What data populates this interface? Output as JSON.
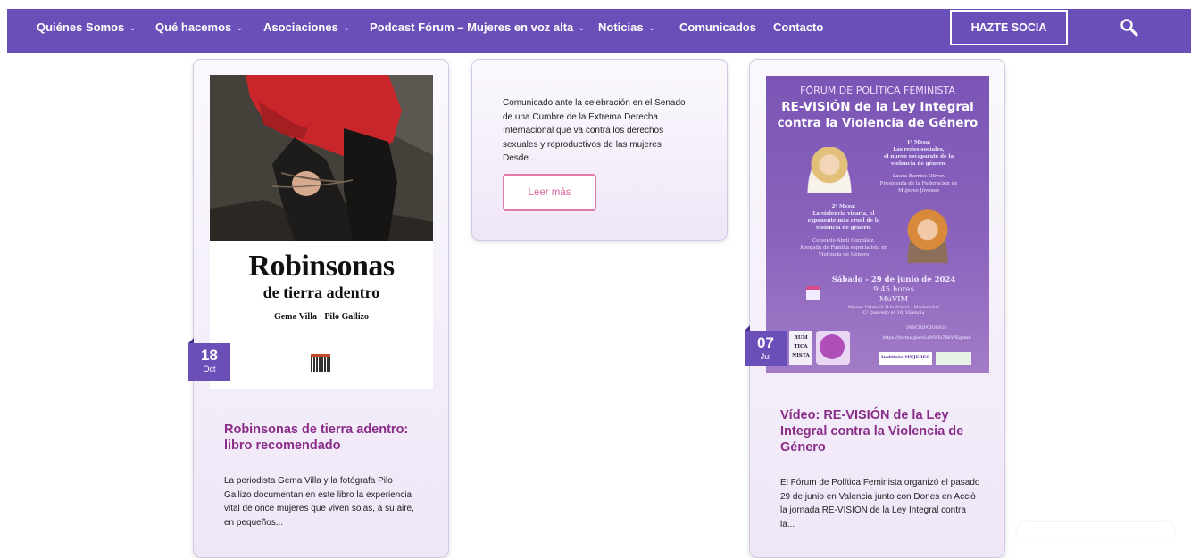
{
  "nav": {
    "items": [
      {
        "label": "Quiénes Somos",
        "chevron": true
      },
      {
        "label": "Qué hacemos",
        "chevron": true
      },
      {
        "label": "Asociaciones",
        "chevron": true
      },
      {
        "label": "Podcast Fórum – Mujeres en voz alta",
        "chevron": true
      },
      {
        "label": "Noticias",
        "chevron": true
      },
      {
        "label": "Comunicados",
        "chevron": false
      },
      {
        "label": "Contacto",
        "chevron": false
      }
    ],
    "cta_label": "HAZTE SOCIA",
    "search_icon": "search-icon"
  },
  "colors": {
    "nav_bg": "#6b4fb8",
    "title": "#8a2d88",
    "badge": "#6b4fb8",
    "leer_border": "#e07aab"
  },
  "cards": [
    {
      "date_day": "18",
      "date_month": "Oct",
      "book": {
        "title_line1": "Robinsonas",
        "title_line2": "de tierra adentro",
        "authors": "Gema Villa · Pilo Gallizo"
      },
      "title": "Robinsonas de tierra adentro: libro recomendado",
      "excerpt": "La periodista Gema Villa y la fotógrafa Pilo Gallizo documentan en este libro la experiencia vital de once mujeres que viven solas, a su aire, en pequeños..."
    },
    {
      "excerpt": "Comunicado ante la celebración en el Senado de una Cumbre de la Extrema Derecha Internacional que va contra los derechos sexuales y reproductivos de las mujeres Desde...",
      "read_more": "Leer más"
    },
    {
      "date_day": "07",
      "date_month": "Jul",
      "poster": {
        "header": "FÓRUM DE POLÍTICA FEMINISTA",
        "title_line1": "RE-VISIÓN de la Ley Integral",
        "title_line2": "contra la Violencia de Género",
        "mesa1": "1ª Mesa:",
        "mesa1_desc1": "Las redes sociales,",
        "mesa1_desc2": "el nuevo escaparate de la",
        "mesa1_desc3": "violencia de género.",
        "speaker1": "Laura Barrios Oliver.",
        "speaker1_role1": "Presidenta de la Federación de",
        "speaker1_role2": "Mujeres Jóvenes",
        "mesa2": "2ª Mesa:",
        "mesa2_desc1": "La violencia vicaria, el",
        "mesa2_desc2": "exponente más cruel de la",
        "mesa2_desc3": "violencia de género.",
        "speaker2": "Consuelo Abril González.",
        "speaker2_role1": "Abogada de Familia especialista en",
        "speaker2_role2": "Violencia de Género",
        "date": "Sábado - 29 de junio de 2024",
        "time": "9:45 horas",
        "venue": "MuVIM",
        "address1": "Museu Valencià Il·lustració i Modernitat",
        "address2": "C/ Quevedo nº 10, Valencia",
        "inscripciones": "INSCRIPCIONES:",
        "url": "https://forms.gle/eLrMVTs7BkWKqzm6",
        "logo_text": "RUM TICA NISTA",
        "logo_instituto": "Instituto MUJERES"
      },
      "title": "Vídeo: RE-VISIÓN de la Ley Integral contra la Violencia de Género",
      "excerpt": "El Fórum de Política Feminista organizó el pasado 29 de junio en Valencia junto con Dones en Acciò la jornada RE-VISIÓN de la Ley Integral contra la..."
    }
  ]
}
